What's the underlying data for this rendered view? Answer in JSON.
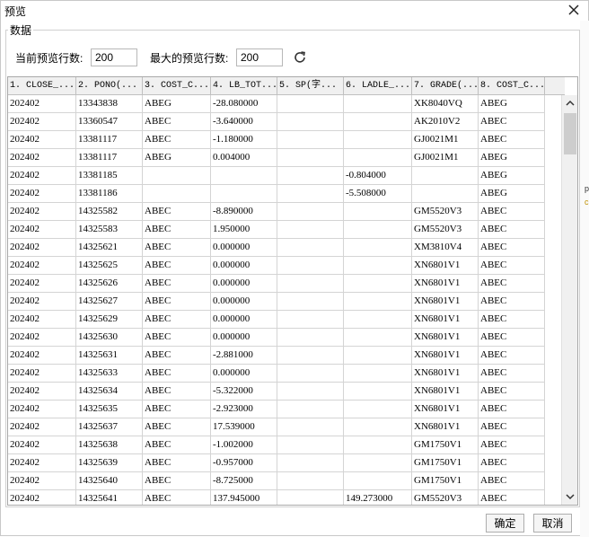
{
  "window": {
    "title": "预览"
  },
  "group": {
    "label": "数据"
  },
  "controls": {
    "preview_rows_label": "当前预览行数:",
    "preview_rows_value": "200",
    "max_rows_label": "最大的预览行数:",
    "max_rows_value": "200"
  },
  "table": {
    "columns": [
      "1. CLOSE_...",
      "2. PONO(...",
      "3. COST_C...",
      "4. LB_TOT...",
      "5. SP(字...",
      "6. LADLE_...",
      "7. GRADE(...",
      "8. COST_C..."
    ],
    "rows": [
      [
        "202402",
        "13343838",
        "ABEG",
        "-28.080000",
        "",
        "",
        "XK8040VQ",
        "ABEG"
      ],
      [
        "202402",
        "13360547",
        "ABEC",
        "-3.640000",
        "",
        "",
        "AK2010V2",
        "ABEC"
      ],
      [
        "202402",
        "13381117",
        "ABEC",
        "-1.180000",
        "",
        "",
        "GJ0021M1",
        "ABEC"
      ],
      [
        "202402",
        "13381117",
        "ABEG",
        "0.004000",
        "",
        "",
        "GJ0021M1",
        "ABEG"
      ],
      [
        "202402",
        "13381185",
        "",
        "",
        "",
        "-0.804000",
        "",
        "ABEG"
      ],
      [
        "202402",
        "13381186",
        "",
        "",
        "",
        "-5.508000",
        "",
        "ABEG"
      ],
      [
        "202402",
        "14325582",
        "ABEC",
        "-8.890000",
        "",
        "",
        "GM5520V3",
        "ABEC"
      ],
      [
        "202402",
        "14325583",
        "ABEC",
        "1.950000",
        "",
        "",
        "GM5520V3",
        "ABEC"
      ],
      [
        "202402",
        "14325621",
        "ABEC",
        "0.000000",
        "",
        "",
        "XM3810V4",
        "ABEC"
      ],
      [
        "202402",
        "14325625",
        "ABEC",
        "0.000000",
        "",
        "",
        "XN6801V1",
        "ABEC"
      ],
      [
        "202402",
        "14325626",
        "ABEC",
        "0.000000",
        "",
        "",
        "XN6801V1",
        "ABEC"
      ],
      [
        "202402",
        "14325627",
        "ABEC",
        "0.000000",
        "",
        "",
        "XN6801V1",
        "ABEC"
      ],
      [
        "202402",
        "14325629",
        "ABEC",
        "0.000000",
        "",
        "",
        "XN6801V1",
        "ABEC"
      ],
      [
        "202402",
        "14325630",
        "ABEC",
        "0.000000",
        "",
        "",
        "XN6801V1",
        "ABEC"
      ],
      [
        "202402",
        "14325631",
        "ABEC",
        "-2.881000",
        "",
        "",
        "XN6801V1",
        "ABEC"
      ],
      [
        "202402",
        "14325633",
        "ABEC",
        "0.000000",
        "",
        "",
        "XN6801V1",
        "ABEC"
      ],
      [
        "202402",
        "14325634",
        "ABEC",
        "-5.322000",
        "",
        "",
        "XN6801V1",
        "ABEC"
      ],
      [
        "202402",
        "14325635",
        "ABEC",
        "-2.923000",
        "",
        "",
        "XN6801V1",
        "ABEC"
      ],
      [
        "202402",
        "14325637",
        "ABEC",
        "17.539000",
        "",
        "",
        "XN6801V1",
        "ABEC"
      ],
      [
        "202402",
        "14325638",
        "ABEC",
        "-1.002000",
        "",
        "",
        "GM1750V1",
        "ABEC"
      ],
      [
        "202402",
        "14325639",
        "ABEC",
        "-0.957000",
        "",
        "",
        "GM1750V1",
        "ABEC"
      ],
      [
        "202402",
        "14325640",
        "ABEC",
        "-8.725000",
        "",
        "",
        "GM1750V1",
        "ABEC"
      ],
      [
        "202402",
        "14325641",
        "ABEC",
        "137.945000",
        "",
        "149.273000",
        "GM5520V3",
        "ABEC"
      ]
    ]
  },
  "footer": {
    "ok_label": "确定",
    "cancel_label": "取消"
  },
  "icons": {
    "close": "close-icon",
    "refresh": "refresh-icon",
    "scroll_up": "chevron-up-icon",
    "scroll_down": "chevron-down-icon"
  },
  "colors": {
    "header_bg": "#f0f0f0",
    "grid_line": "#d4d4d4",
    "scroll_thumb": "#cdcdcd"
  }
}
